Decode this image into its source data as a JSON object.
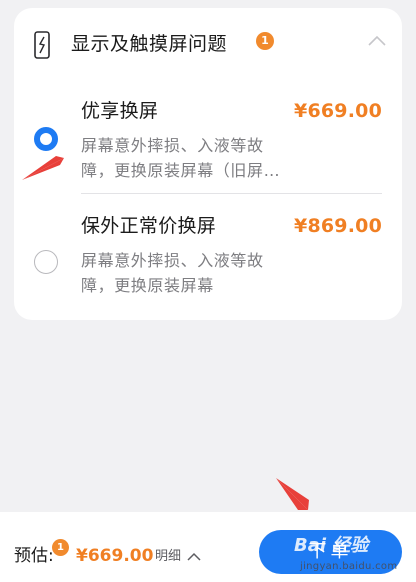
{
  "section": {
    "title": "显示及触摸屏问题",
    "badge_count": "1",
    "header_icon": "phone-broken-screen-icon",
    "collapse_icon": "chevron-up-icon"
  },
  "options": [
    {
      "title": "优享换屏",
      "price": "¥669.00",
      "description_line1": "屏幕意外摔损、入液等故",
      "description_line2": "障，更换原装屏幕（旧屏…",
      "selected": true
    },
    {
      "title": "保外正常价换屏",
      "price": "¥869.00",
      "description_line1": "屏幕意外摔损、入液等故",
      "description_line2": "障，更换原装屏幕",
      "selected": false
    }
  ],
  "footer": {
    "estimate_label": "预估:",
    "estimate_badge": "1",
    "estimate_price": "¥669.00",
    "detail_label": "明细",
    "submit_label": "下单"
  },
  "watermark": {
    "main": "Bai 经验",
    "sub": "jingyan.baidu.com"
  },
  "colors": {
    "accent": "#1e7bf3",
    "price": "#f07f23",
    "badge": "#f18a2d",
    "arrow": "#e8403a"
  }
}
